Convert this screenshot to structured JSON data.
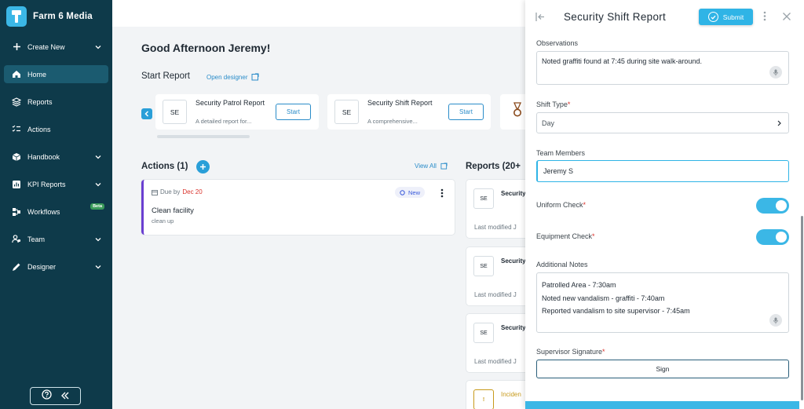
{
  "sidebar": {
    "brand": "Farm 6 Media",
    "items": [
      {
        "label": "Create New",
        "icon": "plus-icon",
        "chevron": true
      },
      {
        "label": "Home",
        "icon": "home-icon",
        "chevron": false,
        "active": true
      },
      {
        "label": "Reports",
        "icon": "layers-icon",
        "chevron": false
      },
      {
        "label": "Actions",
        "icon": "checklist-icon",
        "chevron": false
      },
      {
        "label": "Handbook",
        "icon": "box-icon",
        "chevron": true
      },
      {
        "label": "KPI Reports",
        "icon": "kpi-icon",
        "chevron": true
      },
      {
        "label": "Workflows",
        "icon": "workflow-icon",
        "chevron": false,
        "badge": "Beta"
      },
      {
        "label": "Team",
        "icon": "team-icon",
        "chevron": true
      },
      {
        "label": "Designer",
        "icon": "pen-icon",
        "chevron": true
      }
    ]
  },
  "main": {
    "greeting": "Good Afternoon Jeremy!",
    "start_report_title": "Start Report",
    "open_designer": "Open designer",
    "templates": [
      {
        "abbr": "SE",
        "title": "Security Patrol Report",
        "desc": "A detailed report for...",
        "start": "Start"
      },
      {
        "abbr": "SE",
        "title": "Security Shift Report",
        "desc": "A comprehensive...",
        "start": "Start"
      }
    ],
    "actions_title": "Actions (1)",
    "view_all": "View All",
    "action": {
      "due_prefix": "Due by",
      "due_date": "Dec 20",
      "status": "New",
      "name": "Clean facility",
      "desc": "clean up"
    },
    "reports_title": "Reports (20+",
    "reports": [
      {
        "abbr": "SE",
        "title": "Security",
        "modified": "Last modified J"
      },
      {
        "abbr": "SE",
        "title": "Security",
        "modified": "Last modified J"
      },
      {
        "abbr": "SE",
        "title": "Security",
        "modified": "Last modified J"
      },
      {
        "abbr": "!",
        "title": "Inciden",
        "modified": ""
      }
    ]
  },
  "panel": {
    "title": "Security Shift Report",
    "submit": "Submit",
    "observations_label": "Observations",
    "observations_value": "Noted graffiti found at 7:45 during site walk-around.",
    "shift_type_label": "Shift Type",
    "shift_type_value": "Day",
    "team_members_label": "Team Members",
    "team_members_value": "Jeremy S",
    "uniform_check_label": "Uniform Check",
    "uniform_check_on": true,
    "equipment_check_label": "Equipment Check",
    "equipment_check_on": true,
    "additional_notes_label": "Additional Notes",
    "additional_notes_lines": [
      "Patrolled Area - 7:30am",
      "Noted new vandalism - graffiti - 7:40am",
      "Reported vandalism to site supervisor - 7:45am"
    ],
    "supervisor_signature_label": "Supervisor Signature",
    "sign": "Sign",
    "required_mark": "*"
  },
  "colors": {
    "sidebar_bg": "#0e3a4a",
    "accent": "#2fb4e6",
    "link": "#2a8cc9",
    "required": "#d9322b",
    "action_border": "#6a3fd1"
  }
}
